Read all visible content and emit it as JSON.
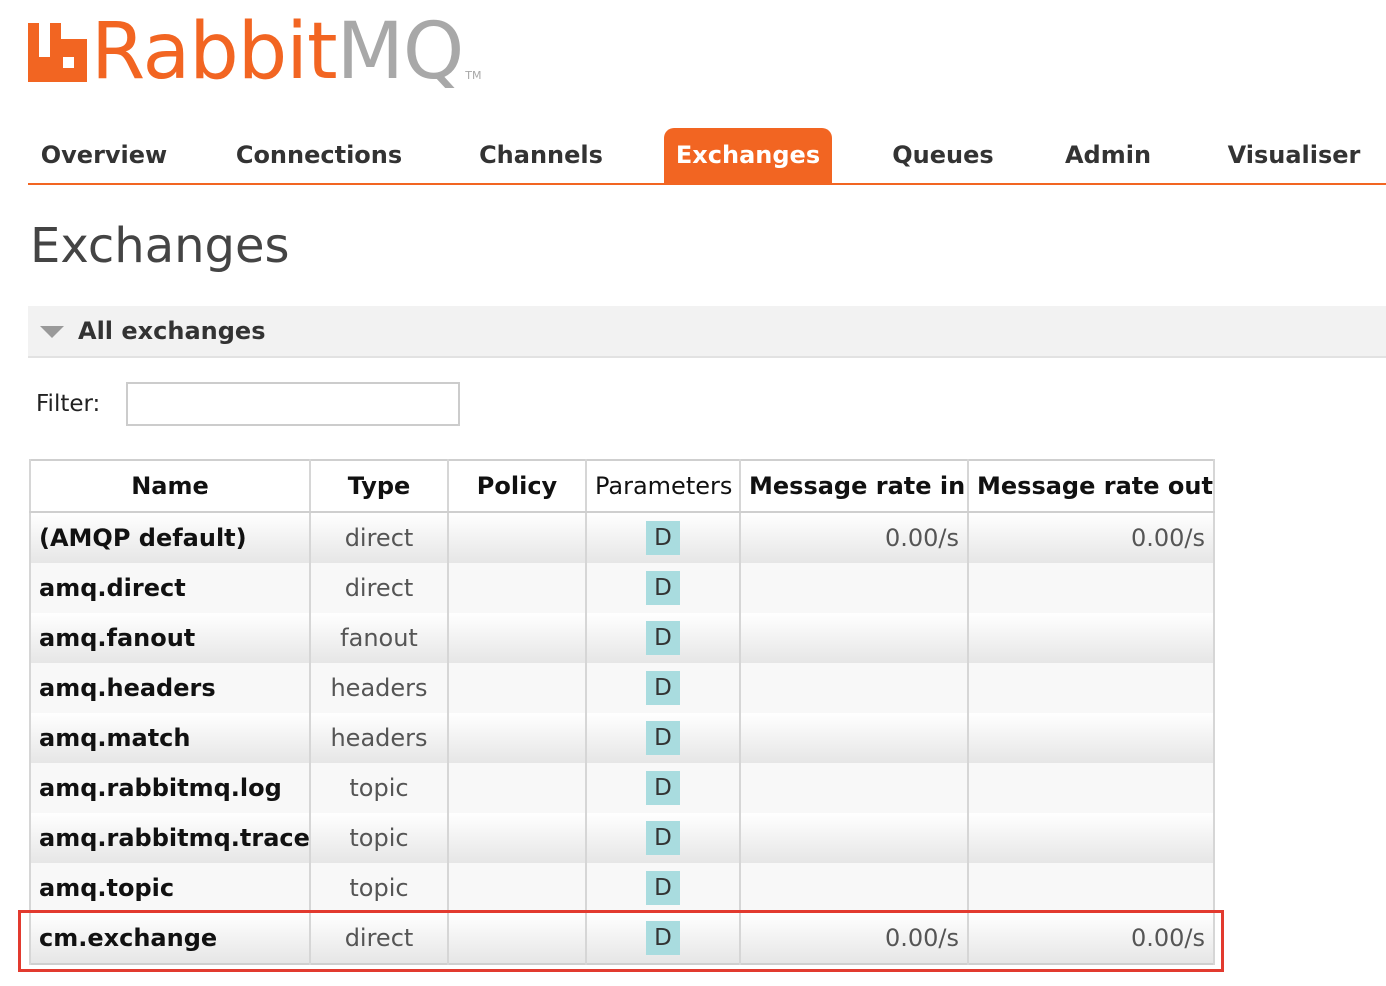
{
  "logo": {
    "brand_primary": "Rabbit",
    "brand_secondary": "MQ",
    "trademark": "TM",
    "brand_color": "#f26522"
  },
  "nav": {
    "tabs": [
      {
        "label": "Overview",
        "active": false
      },
      {
        "label": "Connections",
        "active": false
      },
      {
        "label": "Channels",
        "active": false
      },
      {
        "label": "Exchanges",
        "active": true
      },
      {
        "label": "Queues",
        "active": false
      },
      {
        "label": "Admin",
        "active": false
      },
      {
        "label": "Visualiser",
        "active": false
      }
    ],
    "active_color": "#f26522"
  },
  "page": {
    "title": "Exchanges"
  },
  "section": {
    "title": "All exchanges",
    "expanded": true,
    "icon": "triangle-down-icon"
  },
  "filter": {
    "label": "Filter:",
    "value": "",
    "placeholder": ""
  },
  "table": {
    "headers": {
      "name": "Name",
      "type": "Type",
      "policy": "Policy",
      "parameters": "Parameters",
      "rate_in": "Message rate in",
      "rate_out": "Message rate out"
    },
    "rows": [
      {
        "name": "(AMQP default)",
        "type": "direct",
        "policy": "",
        "parameters": "D",
        "rate_in": "0.00/s",
        "rate_out": "0.00/s"
      },
      {
        "name": "amq.direct",
        "type": "direct",
        "policy": "",
        "parameters": "D",
        "rate_in": "",
        "rate_out": ""
      },
      {
        "name": "amq.fanout",
        "type": "fanout",
        "policy": "",
        "parameters": "D",
        "rate_in": "",
        "rate_out": ""
      },
      {
        "name": "amq.headers",
        "type": "headers",
        "policy": "",
        "parameters": "D",
        "rate_in": "",
        "rate_out": ""
      },
      {
        "name": "amq.match",
        "type": "headers",
        "policy": "",
        "parameters": "D",
        "rate_in": "",
        "rate_out": ""
      },
      {
        "name": "amq.rabbitmq.log",
        "type": "topic",
        "policy": "",
        "parameters": "D",
        "rate_in": "",
        "rate_out": ""
      },
      {
        "name": "amq.rabbitmq.trace",
        "type": "topic",
        "policy": "",
        "parameters": "D",
        "rate_in": "",
        "rate_out": ""
      },
      {
        "name": "amq.topic",
        "type": "topic",
        "policy": "",
        "parameters": "D",
        "rate_in": "",
        "rate_out": ""
      },
      {
        "name": "cm.exchange",
        "type": "direct",
        "policy": "",
        "parameters": "D",
        "rate_in": "0.00/s",
        "rate_out": "0.00/s"
      }
    ],
    "badge_color": "#a9dcdf",
    "highlight_color": "#e23a2f"
  }
}
